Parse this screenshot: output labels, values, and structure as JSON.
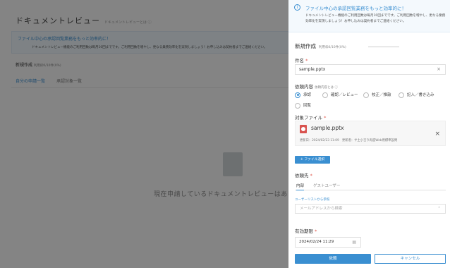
{
  "background": {
    "title": "ドキュメントレビュー",
    "title_sub": "ドキュメントレビューとは ⓘ",
    "banner_title": "ファイル中心の承認回覧業務をもっと効率的に！",
    "banner_body": "ドキュメントレビュー機能のご利用回数は毎月10回までです。ご利用回数を増やし、更なる業務効率化を実現しましょう！お申し込みは契約者までご連絡ください。",
    "new_create": "新規作成",
    "new_usage": "利用枠0/10件(0%)",
    "tabs": [
      "自分の申請一覧",
      "承認対象一覧"
    ],
    "empty_message": "現在申請しているドキュメントレビューはありません"
  },
  "panel": {
    "notice_title": "ファイル中心の承認回覧業務をもっと効率的に！",
    "notice_body": "ドキュメントレビュー機能のご利用回数は毎月10回までです。ご利用回数を増やし、更なる業務効率化を実現しましょう！お申し込みは契約者までご連絡ください。",
    "heading": "新規作成",
    "usage": "利用枠0/10件(0%)",
    "subject_label": "件名",
    "subject_value": "sample.pptx",
    "request_label": "依頼内容",
    "request_help": "依頼内容とは ⓘ",
    "request_options": [
      "承認",
      "確認／レビュー",
      "校正／推敲",
      "記入／書き込み",
      "回覧"
    ],
    "selected_option": "承認",
    "file_label": "対象ファイル",
    "file_name": "sample.pptx",
    "file_meta": "更新日：2024/02/23 11:09　更新者：サ土小吉り再度Web用標準設問",
    "file_select_button": "+ ファイル選択",
    "destination_label": "依頼先",
    "destination_tabs": [
      "内部",
      "ゲストユーザー"
    ],
    "user_list_link": "ユーザーリストから参照",
    "email_placeholder": "メールアドレスから検索",
    "deadline_label": "有効期限",
    "deadline_value": "2024/02/24 11:29",
    "submit_label": "依頼",
    "cancel_label": "キャンセル"
  },
  "colors": {
    "accent": "#3a8fd1",
    "required": "#e0564a",
    "file_icon": "#d9534f"
  },
  "icons": {
    "notice": "info-circle-icon",
    "clear": "close-icon",
    "file": "pptx-file-icon",
    "calendar": "calendar-icon",
    "chevron": "chevron-down-icon"
  }
}
